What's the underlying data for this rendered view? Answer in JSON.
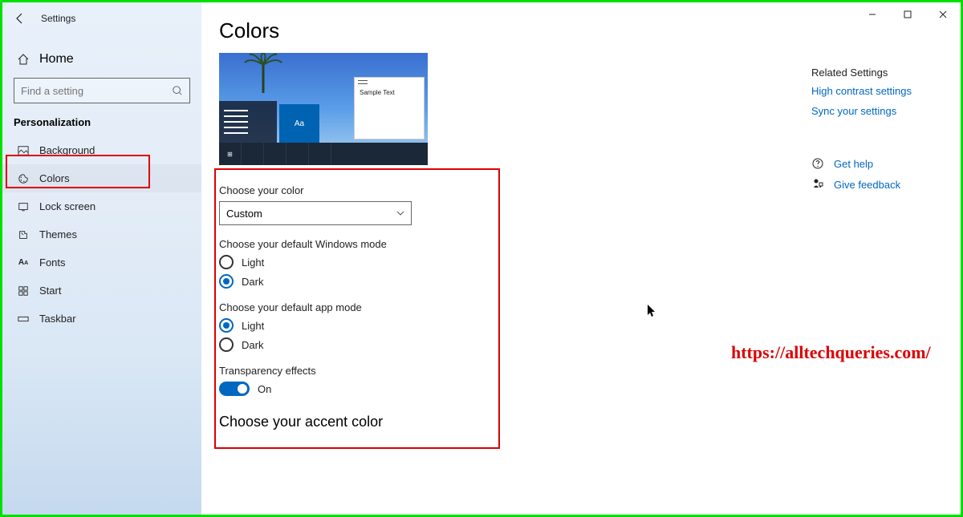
{
  "app_name": "Settings",
  "home_label": "Home",
  "search": {
    "placeholder": "Find a setting"
  },
  "category": "Personalization",
  "sidebar": {
    "items": [
      {
        "label": "Background"
      },
      {
        "label": "Colors"
      },
      {
        "label": "Lock screen"
      },
      {
        "label": "Themes"
      },
      {
        "label": "Fonts"
      },
      {
        "label": "Start"
      },
      {
        "label": "Taskbar"
      }
    ]
  },
  "page": {
    "title": "Colors",
    "preview_sample": "Sample Text",
    "preview_aa": "Aa",
    "choose_color_label": "Choose your color",
    "color_dropdown_value": "Custom",
    "windows_mode_label": "Choose your default Windows mode",
    "windows_mode_options": {
      "light": "Light",
      "dark": "Dark"
    },
    "app_mode_label": "Choose your default app mode",
    "app_mode_options": {
      "light": "Light",
      "dark": "Dark"
    },
    "transparency_label": "Transparency effects",
    "transparency_value": "On",
    "accent_title": "Choose your accent color"
  },
  "right_panel": {
    "title": "Related Settings",
    "links": {
      "high_contrast": "High contrast settings",
      "sync": "Sync your settings"
    },
    "help": "Get help",
    "feedback": "Give feedback"
  },
  "watermark": "https://alltechqueries.com/"
}
